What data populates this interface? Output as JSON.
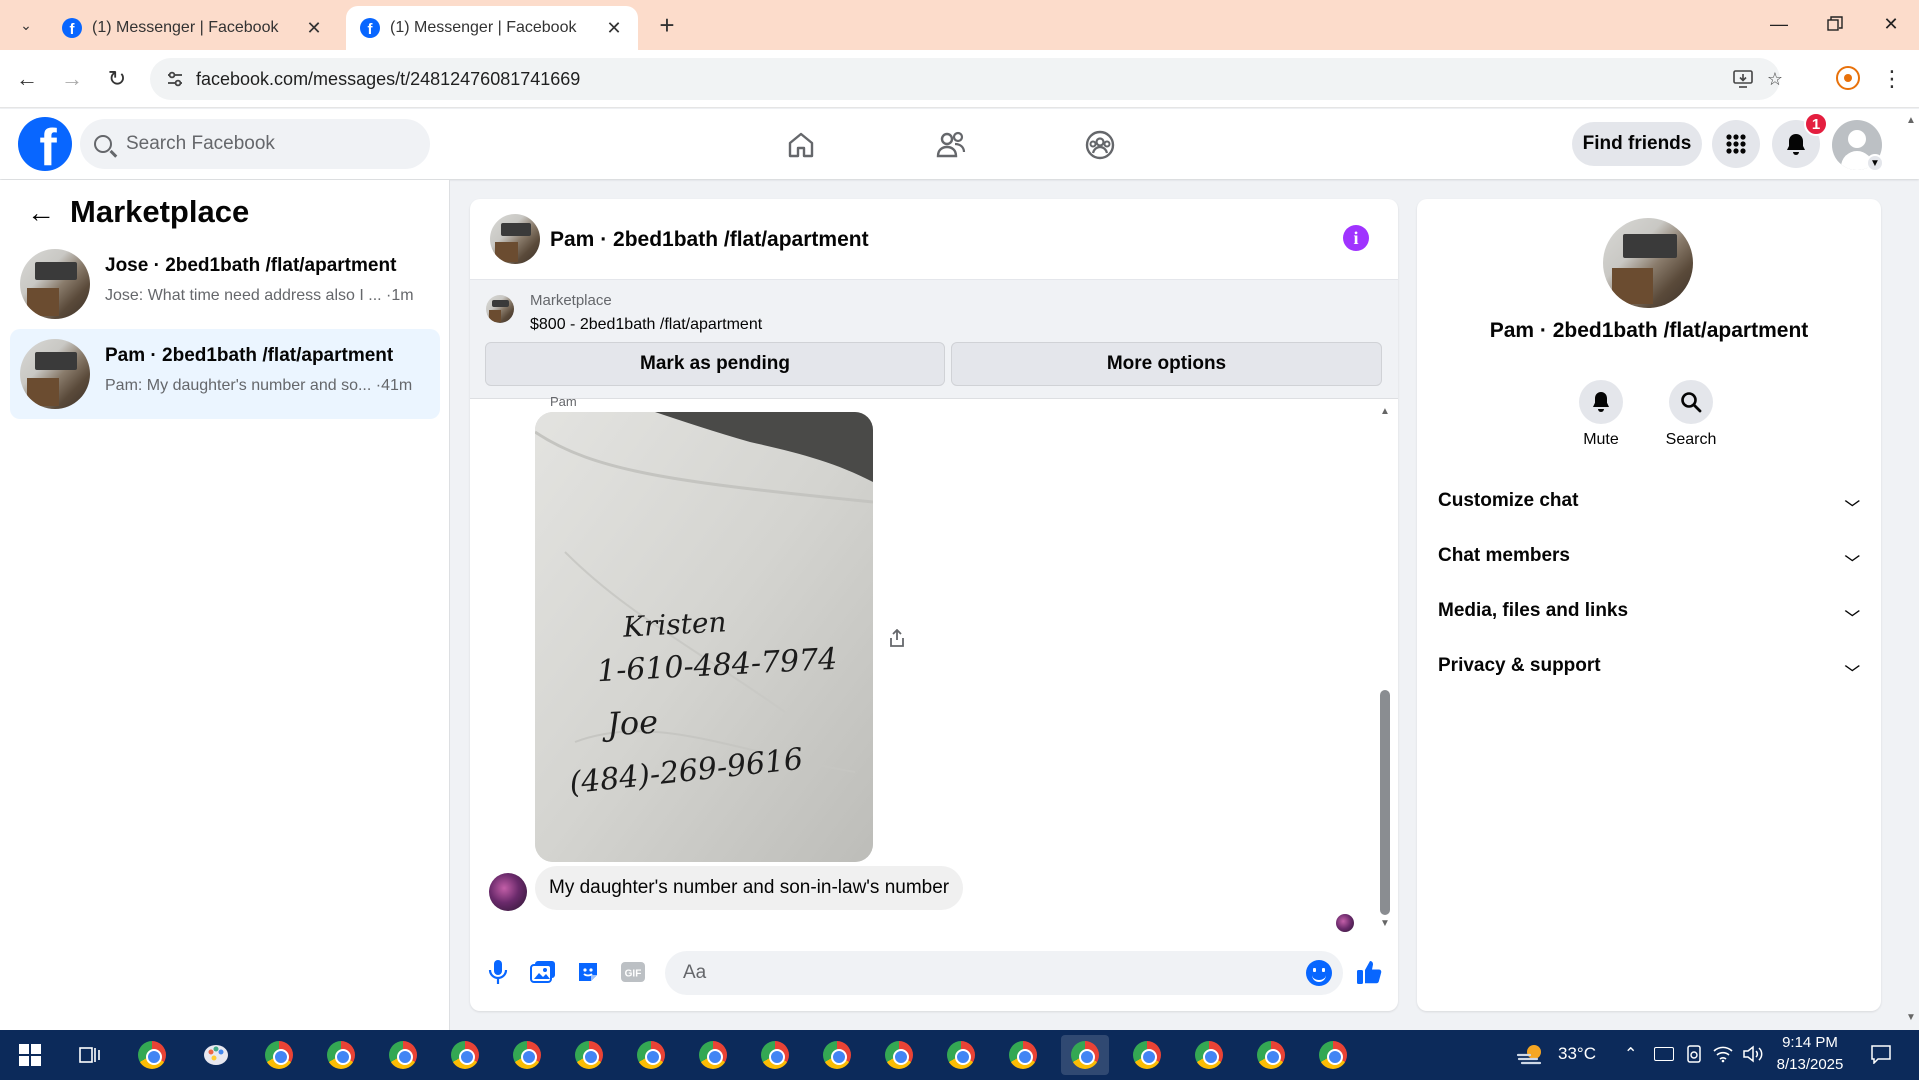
{
  "browser": {
    "tabs": [
      {
        "title": "(1) Messenger | Facebook",
        "active": false
      },
      {
        "title": "(1) Messenger | Facebook",
        "active": true
      }
    ],
    "url": "facebook.com/messages/t/24812476081741669"
  },
  "fb_header": {
    "search_placeholder": "Search Facebook",
    "find_friends_label": "Find friends",
    "notification_count": "1"
  },
  "sidebar": {
    "title": "Marketplace",
    "conversations": [
      {
        "name": "Jose · 2bed1bath /flat/apartment",
        "preview": "Jose: What time need address also I ...  ·1m",
        "active": false
      },
      {
        "name": "Pam · 2bed1bath /flat/apartment",
        "preview": "Pam: My daughter's number and so... ·41m",
        "active": true
      }
    ]
  },
  "chat": {
    "title": "Pam · 2bed1bath /flat/apartment",
    "marketplace_label": "Marketplace",
    "listing": "$800 - 2bed1bath /flat/apartment",
    "mark_pending_label": "Mark as pending",
    "more_options_label": "More options",
    "sender_tag": "Pam",
    "photo_note_lines": [
      "Kristen",
      "1-610-484-7974",
      "Joe",
      "(484)-269-9616"
    ],
    "message_text": "My daughter's number and son-in-law's number",
    "composer_placeholder": "Aa"
  },
  "info_pane": {
    "name": "Pam · 2bed1bath /flat/apartment",
    "actions": [
      {
        "label": "Mute",
        "icon": "bell-icon"
      },
      {
        "label": "Search",
        "icon": "search-icon"
      }
    ],
    "sections": [
      "Customize chat",
      "Chat members",
      "Media, files and links",
      "Privacy & support"
    ]
  },
  "taskbar": {
    "weather": "33°C",
    "time": "9:14 PM",
    "date": "8/13/2025"
  },
  "colors": {
    "fb_blue": "#0866ff",
    "info_purple": "#a033ff",
    "notif_red": "#e41e3f",
    "tab_strip": "#fcdccb",
    "taskbar": "#0c2a5a"
  }
}
